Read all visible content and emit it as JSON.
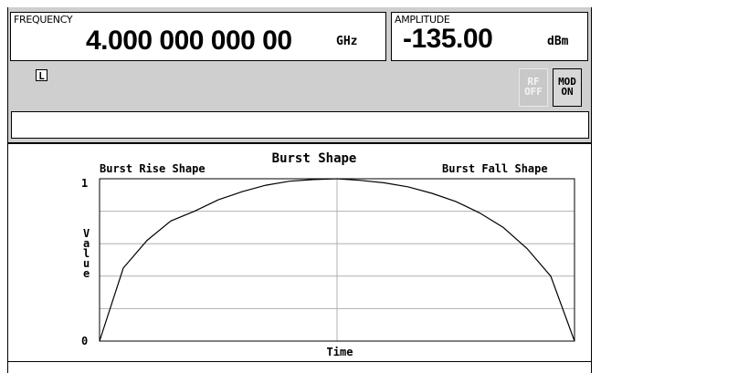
{
  "status": {
    "frequency": {
      "label": "FREQUENCY",
      "value": "4.000 000 000 00",
      "unit": "GHz"
    },
    "amplitude": {
      "label": "AMPLITUDE",
      "value": "-135.00",
      "unit": "dBm"
    },
    "mode_indicator": "L",
    "annunciators": {
      "rf": "RF\nOFF",
      "mod": "MOD\nON"
    },
    "message": ""
  },
  "graph": {
    "title": "Burst Shape",
    "rise_label": "Burst Rise Shape",
    "fall_label": "Burst Fall Shape",
    "ytick_top": "1",
    "ytick_bottom": "0",
    "ylabel_chars": [
      "V",
      "a",
      "l",
      "u",
      "e"
    ],
    "xlabel": "Time"
  },
  "chart_data": {
    "type": "line",
    "title": "Burst Shape",
    "xlabel": "Time",
    "ylabel": "Value",
    "ylim": [
      0,
      1
    ],
    "grid": true,
    "series": [
      {
        "name": "Burst Rise Shape",
        "x": [
          0,
          0.05,
          0.1,
          0.15,
          0.2,
          0.25,
          0.3,
          0.35,
          0.4,
          0.45,
          0.5
        ],
        "values": [
          0,
          0.45,
          0.62,
          0.74,
          0.8,
          0.87,
          0.92,
          0.96,
          0.985,
          0.995,
          1.0
        ]
      },
      {
        "name": "Burst Fall Shape",
        "x": [
          0.5,
          0.55,
          0.6,
          0.65,
          0.7,
          0.75,
          0.8,
          0.85,
          0.9,
          0.95,
          1.0
        ],
        "values": [
          1.0,
          0.99,
          0.975,
          0.95,
          0.91,
          0.86,
          0.79,
          0.7,
          0.57,
          0.4,
          0
        ]
      }
    ]
  }
}
